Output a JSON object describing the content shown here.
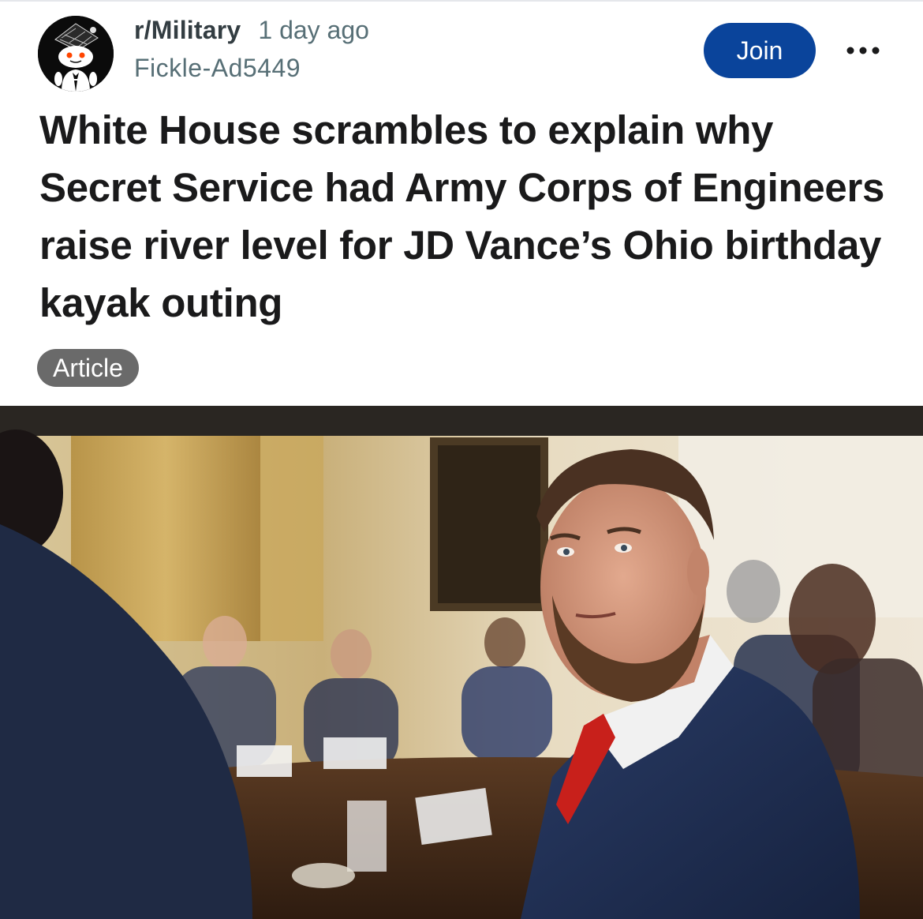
{
  "post": {
    "community": "r/Military",
    "time": "1 day ago",
    "author": "Fickle-Ad5449",
    "join_label": "Join",
    "more_label": "•••",
    "title": "White House scrambles to explain why Secret Service had Army Corps of Engineers raise river level for JD Vance’s Ohio birthday kayak outing",
    "flair": "Article"
  },
  "icons": {
    "avatar": "reddit-snoo-avatar-icon",
    "more": "more-options-icon"
  },
  "colors": {
    "join_button": "#0a449b",
    "flair_background": "#6a6a6a",
    "community_text": "#333d42",
    "meta_text": "#576f76"
  }
}
